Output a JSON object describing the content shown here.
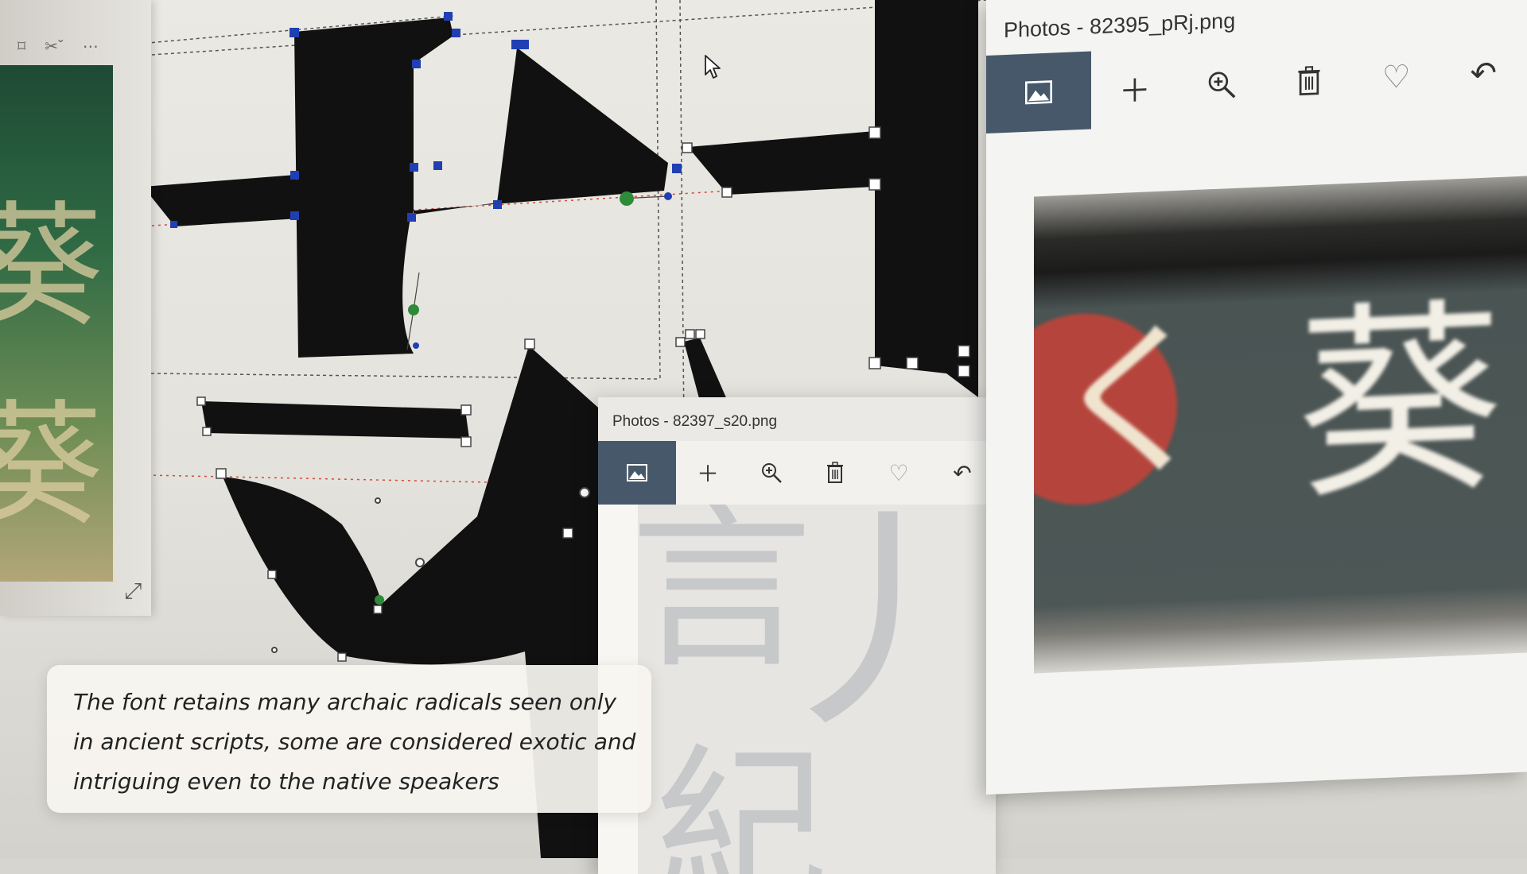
{
  "editor": {
    "left_toolbar_icons": [
      "crop-icon",
      "tools-dropdown-icon",
      "more-icon"
    ],
    "thumbnail_glyph": "葵"
  },
  "photos_large": {
    "title": "Photos - 82395_pRj.png",
    "toolbar_icons": [
      "image-icon",
      "plus-icon",
      "zoom-in-icon",
      "trash-icon",
      "heart-icon",
      "rotate-icon"
    ],
    "image_glyph": "葵"
  },
  "photos_small": {
    "title": "Photos - 82397_s20.png",
    "toolbar_icons": [
      "image-icon",
      "plus-icon",
      "zoom-in-icon",
      "trash-icon",
      "heart-icon",
      "rotate-icon"
    ]
  },
  "caption": {
    "text": "The font retains many archaic radicals seen only in ancient scripts, some are considered exotic and intriguing even to the native speakers"
  },
  "colors": {
    "active_toolbar": "#47586b",
    "glyph": "#111111",
    "control_point": "#1f3fb3",
    "smooth_point": "#2e8b3a",
    "guide_red": "#d24a3a"
  }
}
